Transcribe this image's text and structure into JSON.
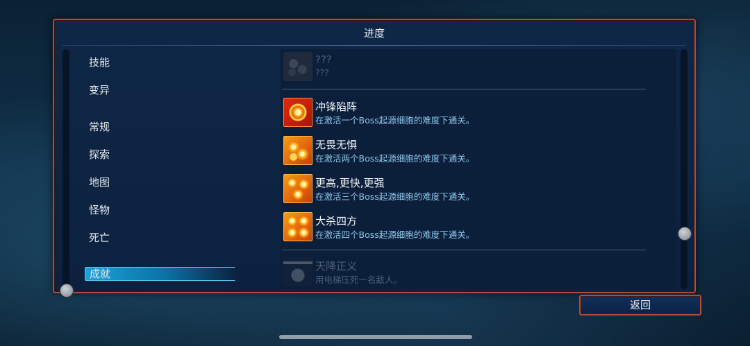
{
  "panel": {
    "title": "进度"
  },
  "categories": [
    {
      "label": "技能",
      "active": false
    },
    {
      "label": "变异",
      "active": false
    },
    {
      "label": "常规",
      "active": false
    },
    {
      "label": "探索",
      "active": false
    },
    {
      "label": "地图",
      "active": false
    },
    {
      "label": "怪物",
      "active": false
    },
    {
      "label": "死亡",
      "active": false
    },
    {
      "label": "成就",
      "active": true
    }
  ],
  "achievements": [
    {
      "name": "???",
      "description": "???",
      "icon": "locked-gears-icon",
      "state": "locked"
    },
    {
      "name": "冲锋陷阵",
      "description": "在激活一个Boss起源细胞的难度下通关。",
      "icon": "one-boss-cell-icon",
      "state": "unlocked"
    },
    {
      "name": "无畏无惧",
      "description": "在激活两个Boss起源细胞的难度下通关。",
      "icon": "two-boss-cells-icon",
      "state": "unlocked"
    },
    {
      "name": "更高,更快,更强",
      "description": "在激活三个Boss起源细胞的难度下通关。",
      "icon": "three-boss-cells-icon",
      "state": "unlocked"
    },
    {
      "name": "大杀四方",
      "description": "在激活四个Boss起源细胞的难度下通关。",
      "icon": "four-boss-cells-icon",
      "state": "unlocked"
    },
    {
      "name": "天降正义",
      "description": "用电梯压死一名敌人。",
      "icon": "elevator-skull-icon",
      "state": "locked"
    }
  ],
  "back_button": {
    "label": "返回"
  },
  "colors": {
    "frame": "#b24a3a",
    "panel": "#0f2746",
    "accent": "#1aa3d8",
    "description": "#8ec5ea"
  }
}
